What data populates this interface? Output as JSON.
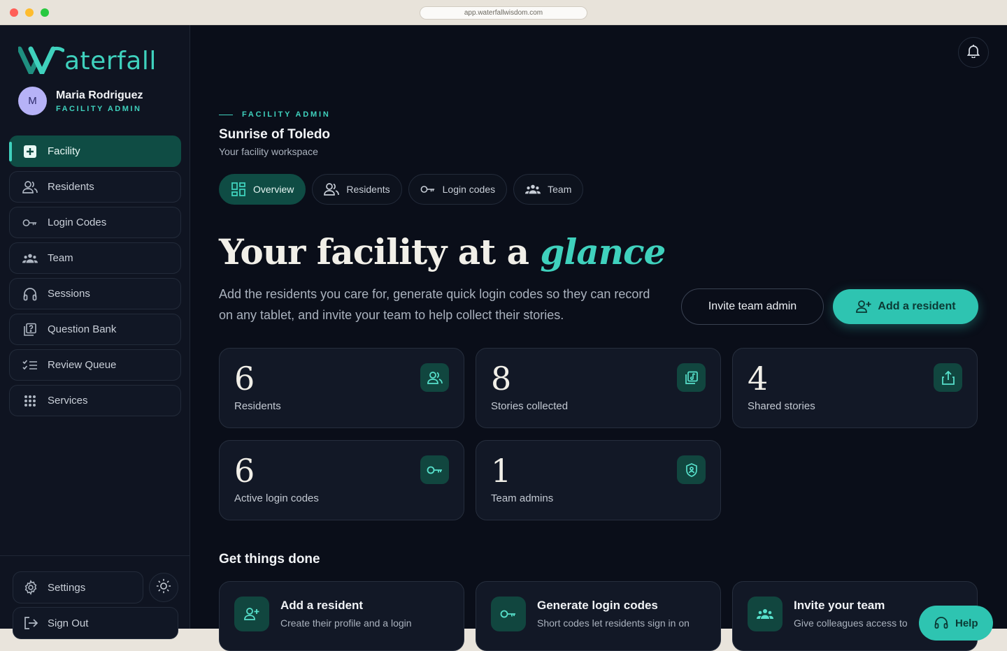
{
  "browser": {
    "url": "app.waterfallwisdom.com"
  },
  "brand": {
    "name": "aterfall",
    "icon": "waterfall-w-logo"
  },
  "user": {
    "initial": "M",
    "name": "Maria Rodriguez",
    "role": "FACILITY ADMIN"
  },
  "sidebar": {
    "items": [
      {
        "label": "Facility",
        "icon": "plus-square-icon",
        "active": true
      },
      {
        "label": "Residents",
        "icon": "users-icon"
      },
      {
        "label": "Login Codes",
        "icon": "key-icon"
      },
      {
        "label": "Team",
        "icon": "team-icon"
      },
      {
        "label": "Sessions",
        "icon": "headphones-icon"
      },
      {
        "label": "Question Bank",
        "icon": "question-book-icon"
      },
      {
        "label": "Review Queue",
        "icon": "checklist-icon"
      },
      {
        "label": "Services",
        "icon": "grid-dots-icon"
      }
    ],
    "settings_label": "Settings",
    "signout_label": "Sign Out"
  },
  "header": {
    "eyebrow": "FACILITY ADMIN",
    "facility_name": "Sunrise of Toledo",
    "facility_sub": "Your facility workspace"
  },
  "tabs": [
    {
      "label": "Overview",
      "icon": "dashboard-icon",
      "active": true
    },
    {
      "label": "Residents",
      "icon": "users-icon"
    },
    {
      "label": "Login codes",
      "icon": "key-icon"
    },
    {
      "label": "Team",
      "icon": "team-icon"
    }
  ],
  "hero": {
    "title_prefix": "Your facility at a ",
    "title_accent": "glance",
    "description": "Add the residents you care for, generate quick login codes so they can record on any tablet, and invite your team to help collect their stories.",
    "invite_label": "Invite team admin",
    "add_label": "Add a resident"
  },
  "stats": [
    {
      "value": "6",
      "label": "Residents",
      "icon": "users-icon"
    },
    {
      "value": "8",
      "label": "Stories collected",
      "icon": "stories-icon"
    },
    {
      "value": "4",
      "label": "Shared stories",
      "icon": "share-icon"
    },
    {
      "value": "6",
      "label": "Active login codes",
      "icon": "key-icon"
    },
    {
      "value": "1",
      "label": "Team admins",
      "icon": "shield-icon"
    }
  ],
  "get_things_done": {
    "title": "Get things done",
    "actions": [
      {
        "title": "Add a resident",
        "desc": "Create their profile and a login",
        "icon": "user-plus-icon"
      },
      {
        "title": "Generate login codes",
        "desc": "Short codes let residents sign in on",
        "icon": "key-icon"
      },
      {
        "title": "Invite your team",
        "desc": "Give colleagues access to",
        "icon": "team-icon"
      }
    ]
  },
  "help_label": "Help",
  "colors": {
    "accent": "#3fd1bd",
    "background": "#0a0e19",
    "sidebar": "#0f1421",
    "active": "#0f4c44",
    "primary_button": "#2ec4b1"
  }
}
